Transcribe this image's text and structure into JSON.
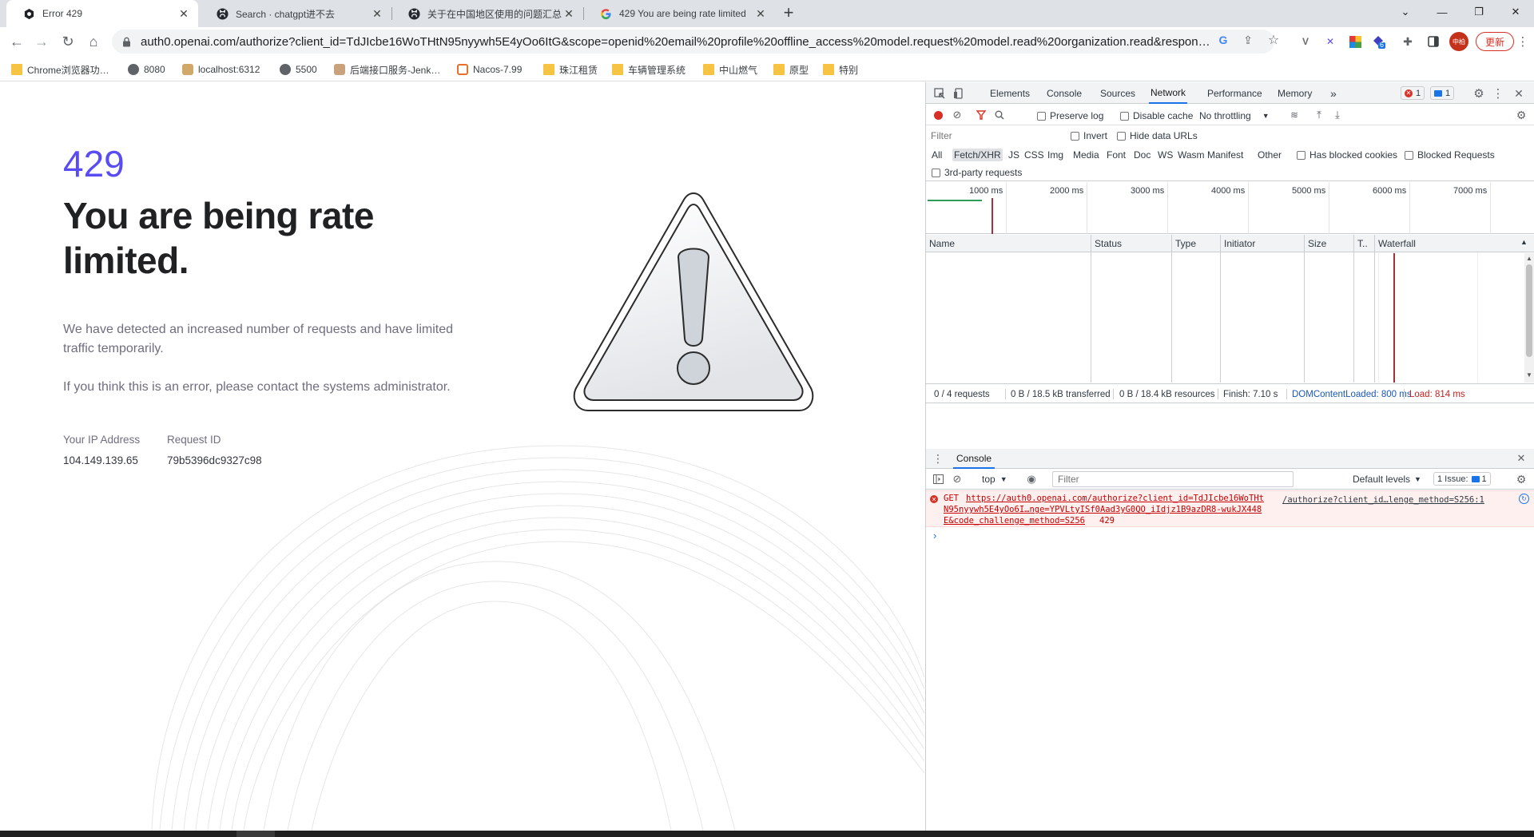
{
  "tabs": [
    {
      "title": "Error 429",
      "icon": "openai-icon"
    },
    {
      "title": "Search · chatgpt进不去",
      "icon": "github-icon"
    },
    {
      "title": "关于在中国地区使用的问题汇总",
      "icon": "github-icon"
    },
    {
      "title": "429 You are being rate limited",
      "icon": "google-icon"
    }
  ],
  "new_tab": "+",
  "window_controls": {
    "dropdown": "⌄",
    "minimize": "—",
    "maximize": "❐",
    "close": "✕"
  },
  "toolbar": {
    "back": "←",
    "forward": "→",
    "reload": "↻",
    "home": "⌂",
    "url": "auth0.openai.com/authorize?client_id=TdJIcbe16WoTHtN95nyywh5E4yOo6ItG&scope=openid%20email%20profile%20offline_access%20model.request%20model.read%20organization.read&respon…",
    "update_label": "更新",
    "profile_initials": "中柏",
    "extension_badge": "6"
  },
  "bookmarks": [
    {
      "label": "Chrome浏览器功…",
      "icon": "folder-icon"
    },
    {
      "label": "8080",
      "icon": "globe-icon"
    },
    {
      "label": "localhost:6312",
      "icon": "jenkins-icon"
    },
    {
      "label": "5500",
      "icon": "globe-icon"
    },
    {
      "label": "后端接口服务-Jenk…",
      "icon": "jenkins-icon"
    },
    {
      "label": "Nacos-7.99",
      "icon": "nacos-icon"
    },
    {
      "label": "珠江租赁",
      "icon": "folder-icon"
    },
    {
      "label": "车辆管理系统",
      "icon": "folder-icon"
    },
    {
      "label": "中山燃气",
      "icon": "folder-icon"
    },
    {
      "label": "原型",
      "icon": "folder-icon"
    },
    {
      "label": "特别",
      "icon": "folder-icon"
    }
  ],
  "page": {
    "code": "429",
    "title": "You are being rate limited.",
    "paragraph1": "We have detected an increased number of requests and have limited traffic temporarily.",
    "paragraph2": "If you think this is an error, please contact the systems administrator.",
    "ip_label": "Your IP Address",
    "ip_value": "104.149.139.65",
    "request_label": "Request ID",
    "request_value": "79b5396dc9327c98"
  },
  "devtools": {
    "tabs": [
      "Elements",
      "Console",
      "Sources",
      "Network",
      "Performance",
      "Memory"
    ],
    "active_tab": "Network",
    "more": "»",
    "error_count": "1",
    "message_count": "1",
    "network_toolbar": {
      "preserve_log": "Preserve log",
      "disable_cache": "Disable cache",
      "throttling": "No throttling"
    },
    "filter_placeholder": "Filter",
    "invert": "Invert",
    "hide_data_urls": "Hide data URLs",
    "type_filters": [
      "All",
      "Fetch/XHR",
      "JS",
      "CSS",
      "Img",
      "Media",
      "Font",
      "Doc",
      "WS",
      "Wasm",
      "Manifest",
      "Other"
    ],
    "selected_type": "Fetch/XHR",
    "has_blocked_cookies": "Has blocked cookies",
    "blocked_requests": "Blocked Requests",
    "third_party": "3rd-party requests",
    "overview_ticks": [
      "1000 ms",
      "2000 ms",
      "3000 ms",
      "4000 ms",
      "5000 ms",
      "6000 ms",
      "7000 ms"
    ],
    "columns": [
      "Name",
      "Status",
      "Type",
      "Initiator",
      "Size",
      "T..",
      "Waterfall"
    ],
    "status_bar": {
      "requests": "0 / 4 requests",
      "transferred": "0 B / 18.5 kB transferred",
      "resources": "0 B / 18.4 kB resources",
      "finish": "Finish: 7.10 s",
      "dom_content_loaded": "DOMContentLoaded: 800 ms",
      "load": "Load: 814 ms"
    },
    "console": {
      "tab": "Console",
      "context": "top",
      "filter_placeholder": "Filter",
      "levels": "Default levels",
      "issues": "1 Issue:",
      "issues_count": "1",
      "error_method": "GET",
      "error_url_1": "https://auth0.openai.com/authorize?client_id=TdJIcbe16WoTHt",
      "error_url_2": "N95nyywh5E4yOo6I…nge=YPVLtyISf0Aad3yG0QO_iIdjz1B9azDR8-wukJX448",
      "error_url_3": "E&code_challenge_method=S256",
      "error_status": "429",
      "error_source": "/authorize?client_id…lenge_method=S256:1",
      "prompt": "›"
    }
  }
}
